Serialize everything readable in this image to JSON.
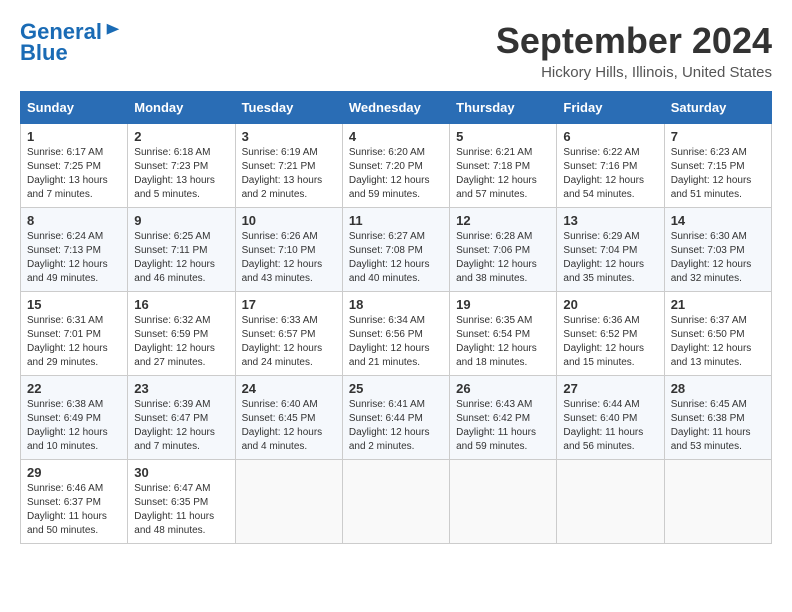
{
  "header": {
    "logo_line1": "General",
    "logo_line2": "Blue",
    "month": "September 2024",
    "location": "Hickory Hills, Illinois, United States"
  },
  "days_of_week": [
    "Sunday",
    "Monday",
    "Tuesday",
    "Wednesday",
    "Thursday",
    "Friday",
    "Saturday"
  ],
  "weeks": [
    [
      {
        "day": 1,
        "sunrise": "6:17 AM",
        "sunset": "7:25 PM",
        "daylight": "13 hours and 7 minutes."
      },
      {
        "day": 2,
        "sunrise": "6:18 AM",
        "sunset": "7:23 PM",
        "daylight": "13 hours and 5 minutes."
      },
      {
        "day": 3,
        "sunrise": "6:19 AM",
        "sunset": "7:21 PM",
        "daylight": "13 hours and 2 minutes."
      },
      {
        "day": 4,
        "sunrise": "6:20 AM",
        "sunset": "7:20 PM",
        "daylight": "12 hours and 59 minutes."
      },
      {
        "day": 5,
        "sunrise": "6:21 AM",
        "sunset": "7:18 PM",
        "daylight": "12 hours and 57 minutes."
      },
      {
        "day": 6,
        "sunrise": "6:22 AM",
        "sunset": "7:16 PM",
        "daylight": "12 hours and 54 minutes."
      },
      {
        "day": 7,
        "sunrise": "6:23 AM",
        "sunset": "7:15 PM",
        "daylight": "12 hours and 51 minutes."
      }
    ],
    [
      {
        "day": 8,
        "sunrise": "6:24 AM",
        "sunset": "7:13 PM",
        "daylight": "12 hours and 49 minutes."
      },
      {
        "day": 9,
        "sunrise": "6:25 AM",
        "sunset": "7:11 PM",
        "daylight": "12 hours and 46 minutes."
      },
      {
        "day": 10,
        "sunrise": "6:26 AM",
        "sunset": "7:10 PM",
        "daylight": "12 hours and 43 minutes."
      },
      {
        "day": 11,
        "sunrise": "6:27 AM",
        "sunset": "7:08 PM",
        "daylight": "12 hours and 40 minutes."
      },
      {
        "day": 12,
        "sunrise": "6:28 AM",
        "sunset": "7:06 PM",
        "daylight": "12 hours and 38 minutes."
      },
      {
        "day": 13,
        "sunrise": "6:29 AM",
        "sunset": "7:04 PM",
        "daylight": "12 hours and 35 minutes."
      },
      {
        "day": 14,
        "sunrise": "6:30 AM",
        "sunset": "7:03 PM",
        "daylight": "12 hours and 32 minutes."
      }
    ],
    [
      {
        "day": 15,
        "sunrise": "6:31 AM",
        "sunset": "7:01 PM",
        "daylight": "12 hours and 29 minutes."
      },
      {
        "day": 16,
        "sunrise": "6:32 AM",
        "sunset": "6:59 PM",
        "daylight": "12 hours and 27 minutes."
      },
      {
        "day": 17,
        "sunrise": "6:33 AM",
        "sunset": "6:57 PM",
        "daylight": "12 hours and 24 minutes."
      },
      {
        "day": 18,
        "sunrise": "6:34 AM",
        "sunset": "6:56 PM",
        "daylight": "12 hours and 21 minutes."
      },
      {
        "day": 19,
        "sunrise": "6:35 AM",
        "sunset": "6:54 PM",
        "daylight": "12 hours and 18 minutes."
      },
      {
        "day": 20,
        "sunrise": "6:36 AM",
        "sunset": "6:52 PM",
        "daylight": "12 hours and 15 minutes."
      },
      {
        "day": 21,
        "sunrise": "6:37 AM",
        "sunset": "6:50 PM",
        "daylight": "12 hours and 13 minutes."
      }
    ],
    [
      {
        "day": 22,
        "sunrise": "6:38 AM",
        "sunset": "6:49 PM",
        "daylight": "12 hours and 10 minutes."
      },
      {
        "day": 23,
        "sunrise": "6:39 AM",
        "sunset": "6:47 PM",
        "daylight": "12 hours and 7 minutes."
      },
      {
        "day": 24,
        "sunrise": "6:40 AM",
        "sunset": "6:45 PM",
        "daylight": "12 hours and 4 minutes."
      },
      {
        "day": 25,
        "sunrise": "6:41 AM",
        "sunset": "6:44 PM",
        "daylight": "12 hours and 2 minutes."
      },
      {
        "day": 26,
        "sunrise": "6:43 AM",
        "sunset": "6:42 PM",
        "daylight": "11 hours and 59 minutes."
      },
      {
        "day": 27,
        "sunrise": "6:44 AM",
        "sunset": "6:40 PM",
        "daylight": "11 hours and 56 minutes."
      },
      {
        "day": 28,
        "sunrise": "6:45 AM",
        "sunset": "6:38 PM",
        "daylight": "11 hours and 53 minutes."
      }
    ],
    [
      {
        "day": 29,
        "sunrise": "6:46 AM",
        "sunset": "6:37 PM",
        "daylight": "11 hours and 50 minutes."
      },
      {
        "day": 30,
        "sunrise": "6:47 AM",
        "sunset": "6:35 PM",
        "daylight": "11 hours and 48 minutes."
      },
      null,
      null,
      null,
      null,
      null
    ]
  ]
}
